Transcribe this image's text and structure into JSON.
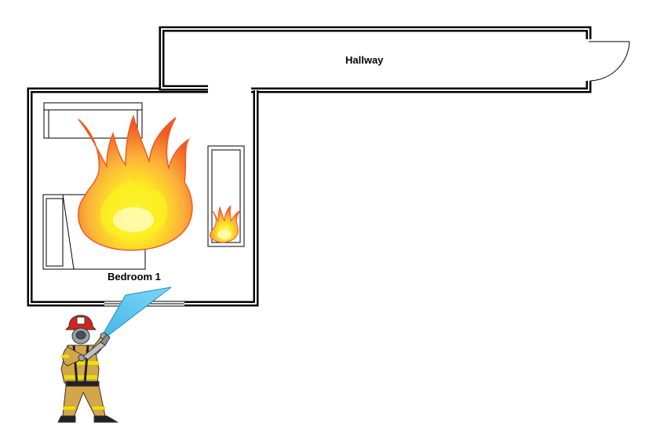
{
  "rooms": {
    "hallway": {
      "label": "Hallway"
    },
    "bedroom": {
      "label": "Bedroom 1"
    }
  },
  "icons": {
    "large_fire": "fire-icon",
    "small_fire": "fire-icon",
    "firefighter": "firefighter-icon",
    "hose_stream": "water-stream-icon",
    "door": "door-swing-icon"
  },
  "colors": {
    "wall": "#000000",
    "wall_fill": "#ffffff",
    "fire_outer": "#f15a24",
    "fire_mid": "#fbb03b",
    "fire_inner": "#fcee21",
    "water": "#5bc8f0",
    "turnout_gear": "#d4a64a",
    "reflective_stripe": "#e8e000",
    "helmet": "#d4231e"
  }
}
